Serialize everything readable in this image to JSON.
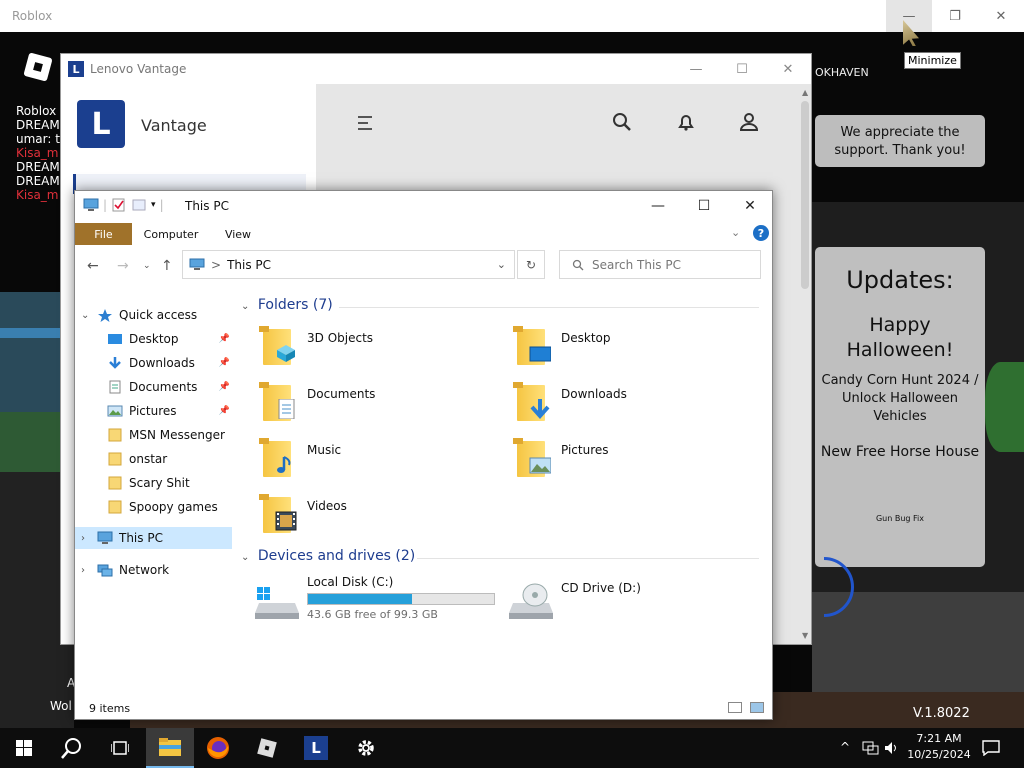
{
  "roblox": {
    "title": "Roblox",
    "controls": {
      "minimize": "—",
      "maximize": "❐",
      "close": "✕"
    },
    "tooltip": "Minimize",
    "chat": [
      {
        "name": "Roblox",
        "color": "#ffffff"
      },
      {
        "name": "DREAM",
        "color": "#ffffff"
      },
      {
        "name": "umar: t",
        "color": "#ffffff"
      },
      {
        "name": "Kisa_m",
        "color": "#e0303a"
      },
      {
        "name": "DREAM",
        "color": "#ffffff"
      },
      {
        "name": "DREAM",
        "color": "#ffffff"
      },
      {
        "name": "Kisa_m",
        "color": "#e0303a"
      }
    ],
    "server_label": "OKHAVEN",
    "thanks_card": "We appreciate the support. Thank you!",
    "updates": {
      "title": "Updates:",
      "headline": "Happy Halloween!",
      "item1": "Candy Corn Hunt 2024 / Unlock Halloween Vehicles",
      "item2": "New Free Horse House",
      "footer": "Gun Bug Fix"
    },
    "version": "V.1.8022",
    "bottom_fragments": [
      "A",
      "Wol"
    ]
  },
  "vantage": {
    "window_title": "Lenovo Vantage",
    "icon_letter": "L",
    "app_name": "Vantage",
    "controls": {
      "minimize": "—",
      "maximize": "☐",
      "close": "✕"
    },
    "toolbar_icons": [
      "menu-icon",
      "search-icon",
      "bell-icon",
      "account-icon"
    ]
  },
  "explorer": {
    "title": "This PC",
    "controls": {
      "minimize": "—",
      "maximize": "☐",
      "close": "✕"
    },
    "ribbon_tabs": {
      "file": "File",
      "computer": "Computer",
      "view": "View"
    },
    "help_glyph": "?",
    "address": {
      "separator": ">",
      "path": "This PC"
    },
    "search_placeholder": "Search This PC",
    "navigation": {
      "quick_access": "Quick access",
      "items": [
        {
          "label": "Desktop",
          "pinned": true,
          "icon": "desktop-icon"
        },
        {
          "label": "Downloads",
          "pinned": true,
          "icon": "downloads-icon"
        },
        {
          "label": "Documents",
          "pinned": true,
          "icon": "documents-icon"
        },
        {
          "label": "Pictures",
          "pinned": true,
          "icon": "pictures-icon"
        },
        {
          "label": "MSN Messenger",
          "pinned": false,
          "icon": "folder-icon"
        },
        {
          "label": "onstar",
          "pinned": false,
          "icon": "folder-icon"
        },
        {
          "label": "Scary Shit",
          "pinned": false,
          "icon": "folder-icon"
        },
        {
          "label": "Spoopy games",
          "pinned": false,
          "icon": "folder-icon"
        }
      ],
      "this_pc": "This PC",
      "network": "Network"
    },
    "folders_header": "Folders (7)",
    "folders": [
      {
        "name": "3D Objects",
        "icon": "3d-objects-icon"
      },
      {
        "name": "Desktop",
        "icon": "desktop-folder-icon"
      },
      {
        "name": "Documents",
        "icon": "documents-folder-icon"
      },
      {
        "name": "Downloads",
        "icon": "downloads-folder-icon"
      },
      {
        "name": "Music",
        "icon": "music-folder-icon"
      },
      {
        "name": "Pictures",
        "icon": "pictures-folder-icon"
      },
      {
        "name": "Videos",
        "icon": "videos-folder-icon"
      }
    ],
    "drives_header": "Devices and drives (2)",
    "drives": [
      {
        "name": "Local Disk (C:)",
        "free_text": "43.6 GB free of 99.3 GB",
        "used_fraction": 0.561,
        "icon": "local-disk-icon"
      },
      {
        "name": "CD Drive (D:)",
        "icon": "cd-drive-icon"
      }
    ],
    "status": "9 items",
    "accent": "#a0722a",
    "selection": "#cce8ff"
  },
  "taskbar": {
    "apps": [
      "start-icon",
      "search-icon",
      "task-view-icon",
      "file-explorer-icon",
      "firefox-icon",
      "roblox-icon",
      "lenovo-vantage-icon",
      "settings-icon"
    ],
    "time": "7:21 AM",
    "date": "10/25/2024"
  }
}
